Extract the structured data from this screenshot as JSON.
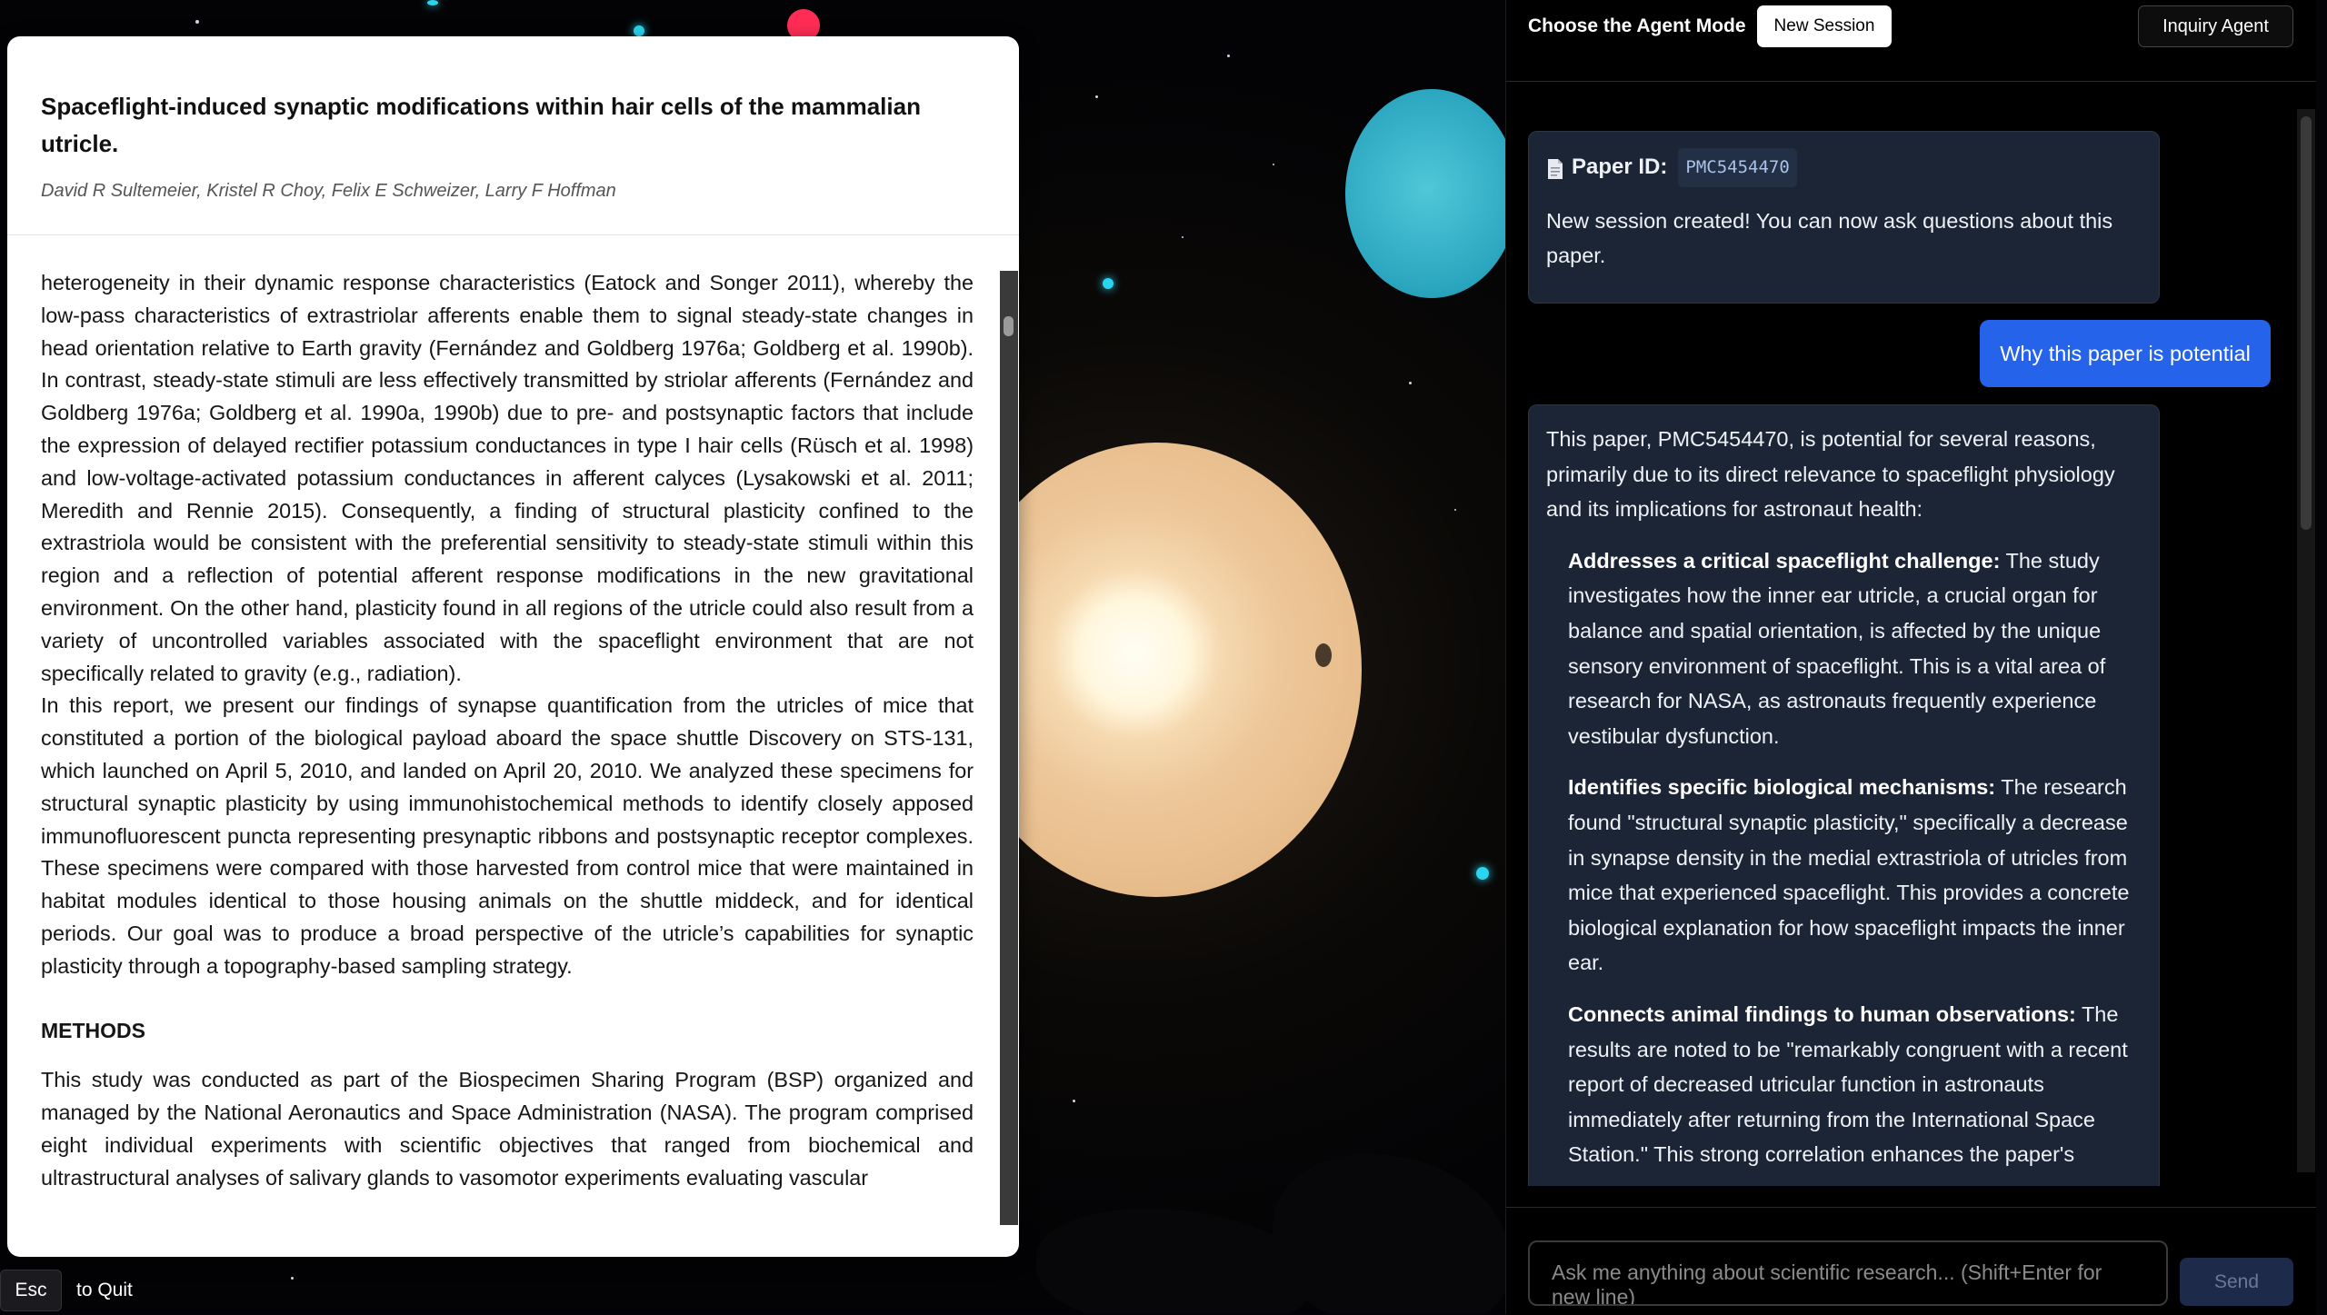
{
  "paper": {
    "title": "Spaceflight-induced synaptic modifications within hair cells of the mammalian utricle.",
    "authors": "David R Sultemeier, Kristel R Choy, Felix E Schweizer, Larry F Hoffman",
    "body_para1": "heterogeneity in their dynamic response characteristics (Eatock and Songer 2011), whereby the low-pass characteristics of extrastriolar afferents enable them to signal steady-state changes in head orientation relative to Earth gravity (Fernández and Goldberg 1976a; Goldberg et al. 1990b). In contrast, steady-state stimuli are less effectively transmitted by striolar afferents (Fernández and Goldberg 1976a; Goldberg et al. 1990a, 1990b) due to pre- and postsynaptic factors that include the expression of delayed rectifier potassium conductances in type I hair cells (Rüsch et al. 1998) and low-voltage-activated potassium conductances in afferent calyces (Lysakowski et al. 2011; Meredith and Rennie 2015). Consequently, a finding of structural plasticity confined to the extrastriola would be consistent with the preferential sensitivity to steady-state stimuli within this region and a reflection of potential afferent response modifications in the new gravitational environment. On the other hand, plasticity found in all regions of the utricle could also result from a variety of uncontrolled variables associated with the spaceflight environment that are not specifically related to gravity (e.g., radiation).",
    "body_para2": "In this report, we present our findings of synapse quantification from the utricles of mice that constituted a portion of the biological payload aboard the space shuttle Discovery on STS-131, which launched on April 5, 2010, and landed on April 20, 2010. We analyzed these specimens for structural synaptic plasticity by using immunohistochemical methods to identify closely apposed immunofluorescent puncta representing presynaptic ribbons and postsynaptic receptor complexes. These specimens were compared with those harvested from control mice that were maintained in habitat modules identical to those housing animals on the shuttle middeck, and for identical periods. Our goal was to produce a broad perspective of the utricle’s capabilities for synaptic plasticity through a topography-based sampling strategy.",
    "methods_heading": "METHODS",
    "methods_para": "This study was conducted as part of the Biospecimen Sharing Program (BSP) organized and managed by the National Aeronautics and Space Administration (NASA). The program comprised eight individual experiments with scientific objectives that ranged from biochemical and ultrastructural analyses of salivary glands to vasomotor experiments evaluating vascular"
  },
  "quit_hint": {
    "key": "Esc",
    "label": "to Quit"
  },
  "chat": {
    "mode_label": "Choose the Agent Mode",
    "new_session_label": "New Session",
    "agent_label": "Inquiry Agent",
    "system_message": {
      "paper_id_label": "Paper ID:",
      "paper_id": "PMC5454470",
      "text": "New session created! You can now ask questions about this paper."
    },
    "user_message": "Why this paper is potential",
    "assistant_message": {
      "intro": "This paper, PMC5454470, is potential for several reasons, primarily due to its direct relevance to spaceflight physiology and its implications for astronaut health:",
      "points": [
        {
          "title": "Addresses a critical spaceflight challenge:",
          "text": " The study investigates how the inner ear utricle, a crucial organ for balance and spatial orientation, is affected by the unique sensory environment of spaceflight. This is a vital area of research for NASA, as astronauts frequently experience vestibular dysfunction."
        },
        {
          "title": "Identifies specific biological mechanisms:",
          "text": " The research found \"structural synaptic plasticity,\" specifically a decrease in synapse density in the medial extrastriola of utricles from mice that experienced spaceflight. This provides a concrete biological explanation for how spaceflight impacts the inner ear."
        },
        {
          "title": "Connects animal findings to human observations:",
          "text": " The results are noted to be \"remarkably congruent with a recent report of decreased utricular function in astronauts immediately after returning from the International Space Station.\" This strong correlation enhances the paper's"
        }
      ]
    },
    "input_placeholder": "Ask me anything about scientific research... (Shift+Enter for new line)",
    "send_label": "Send"
  },
  "icons": {
    "doc": "document-icon"
  },
  "colors": {
    "user_bubble": "#2563eb",
    "ai_bubble": "#1c2535",
    "accent_cyan": "#2bd4ee",
    "red_orb": "#ff2d55"
  }
}
